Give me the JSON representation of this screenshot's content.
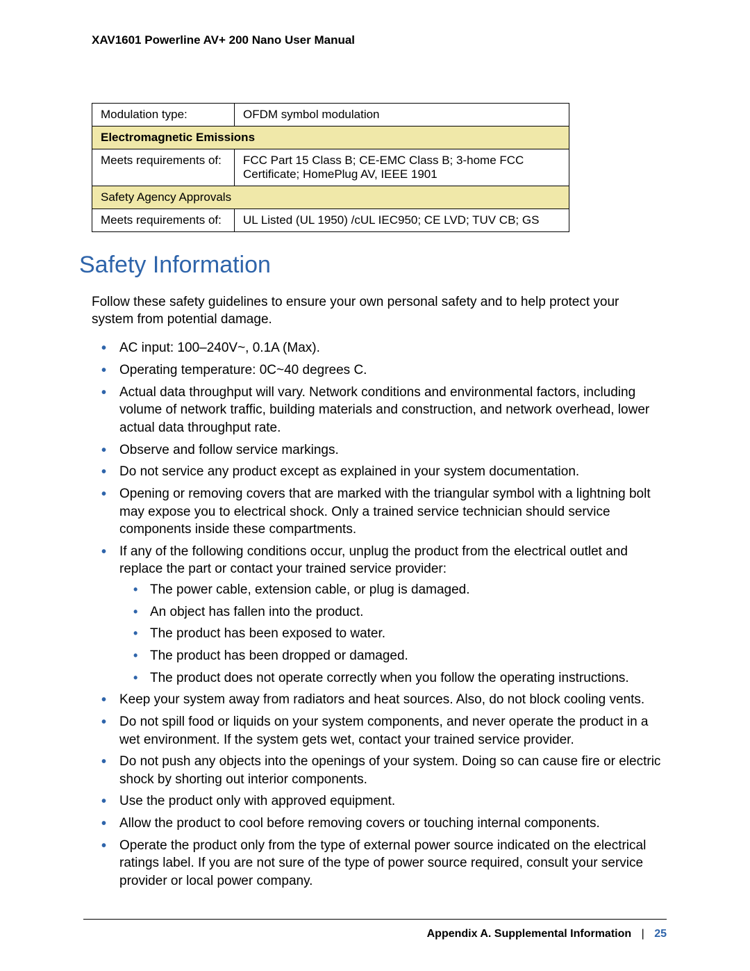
{
  "header": {
    "title": "XAV1601 Powerline AV+ 200 Nano User Manual"
  },
  "table": {
    "row_mod": {
      "label": "Modulation type:",
      "value": "OFDM symbol modulation"
    },
    "header_em": "Electromagnetic Emissions",
    "row_em": {
      "label": "Meets requirements of:",
      "value": "FCC Part 15 Class B; CE-EMC Class B; 3-home FCC Certificate; HomePlug AV, IEEE 1901"
    },
    "header_safety": "Safety Agency Approvals",
    "row_safety": {
      "label": "Meets requirements of:",
      "value": "UL Listed (UL 1950) /cUL IEC950; CE LVD; TUV CB; GS"
    }
  },
  "section_title": "Safety Information",
  "intro": "Follow these safety guidelines to ensure your own personal safety and to help protect your system from potential damage.",
  "bullets": {
    "b0": "AC input: 100–240V~, 0.1A (Max).",
    "b1": "Operating temperature: 0C~40 degrees C.",
    "b2": "Actual data throughput will vary. Network conditions and environmental factors, including volume of network traffic, building materials and construction, and network overhead, lower actual data throughput rate.",
    "b3": "Observe and follow service markings.",
    "b4": "Do not service any product except as explained in your system documentation.",
    "b5": "Opening or removing covers that are marked with the triangular symbol with a lightning bolt may expose you to electrical shock. Only a trained service technician should service components inside these compartments.",
    "b6": "If any of the following conditions occur, unplug the product from the electrical outlet and replace the part or contact your trained service provider:",
    "b6_sub": {
      "s0": "The power cable, extension cable, or plug is damaged.",
      "s1": "An object has fallen into the product.",
      "s2": "The product has been exposed to water.",
      "s3": "The product has been dropped or damaged.",
      "s4": "The product does not operate correctly when you follow the operating instructions."
    },
    "b7": "Keep your system away from radiators and heat sources. Also, do not block cooling vents.",
    "b8": "Do not spill food or liquids on your system components, and never operate the product in a wet environment. If the system gets wet, contact your trained service provider.",
    "b9": "Do not push any objects into the openings of your system. Doing so can cause fire or electric shock by shorting out interior components.",
    "b10": "Use the product only with approved equipment.",
    "b11": "Allow the product to cool before removing covers or touching internal components.",
    "b12": "Operate the product only from the type of external power source indicated on the electrical ratings label. If you are not sure of the type of power source required, consult your service provider or local power company."
  },
  "footer": {
    "appendix": "Appendix A.  Supplemental Information",
    "sep": "|",
    "page": "25"
  }
}
